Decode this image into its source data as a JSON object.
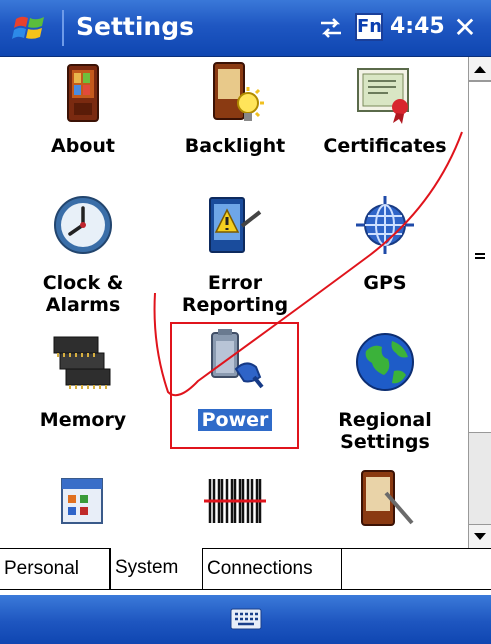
{
  "title_bar": {
    "title": "Settings",
    "fn_label": "Fn",
    "time": "4:45",
    "close_glyph": "✕",
    "icons": [
      "windows-start-icon",
      "connectivity-icon",
      "close-icon"
    ]
  },
  "settings_items": [
    {
      "label_lines": [
        "About"
      ],
      "icon": "about-icon"
    },
    {
      "label_lines": [
        "Backlight"
      ],
      "icon": "backlight-icon"
    },
    {
      "label_lines": [
        "Certificates"
      ],
      "icon": "certificates-icon"
    },
    {
      "label_lines": [
        "Clock &",
        "Alarms"
      ],
      "icon": "clock-icon"
    },
    {
      "label_lines": [
        "Error",
        "Reporting"
      ],
      "icon": "error-reporting-icon"
    },
    {
      "label_lines": [
        "GPS"
      ],
      "icon": "gps-icon"
    },
    {
      "label_lines": [
        "Memory"
      ],
      "icon": "memory-icon"
    },
    {
      "label_lines": [
        "Power"
      ],
      "icon": "power-icon",
      "selected": true
    },
    {
      "label_lines": [
        "Regional",
        "Settings"
      ],
      "icon": "regional-settings-icon"
    },
    {
      "label_lines": [],
      "icon": "remove-programs-icon"
    },
    {
      "label_lines": [],
      "icon": "barcode-icon"
    },
    {
      "label_lines": [],
      "icon": "screen-icon"
    }
  ],
  "tabs": [
    {
      "label": "Personal",
      "active": false
    },
    {
      "label": "System",
      "active": true
    },
    {
      "label": "Connections",
      "active": false
    }
  ],
  "bottom_bar": {
    "input_icon": "keyboard-icon"
  },
  "colors": {
    "titlebar": "#1f57c2",
    "selection": "#2f6bc9",
    "annotation": "#e0141c"
  }
}
